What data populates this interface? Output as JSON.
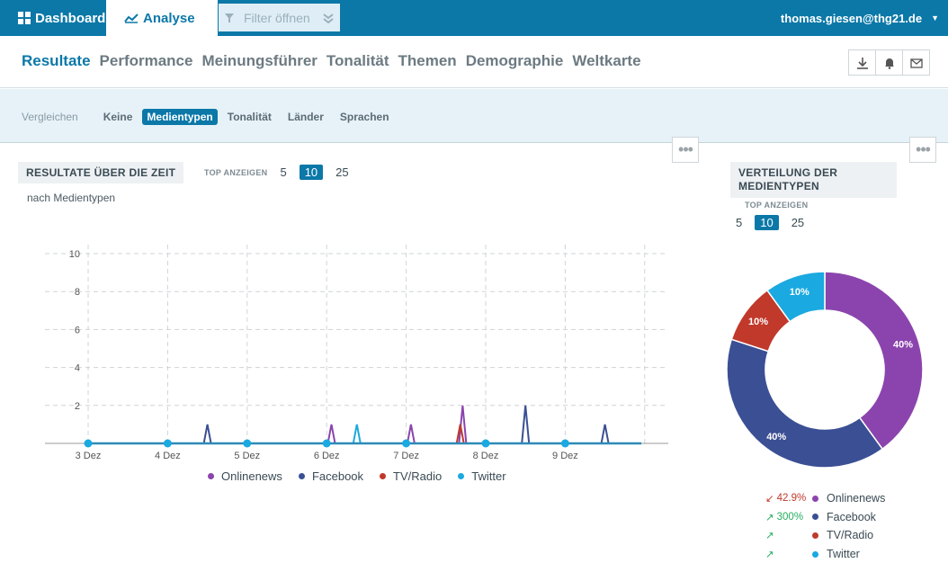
{
  "colors": {
    "accent": "#0b78a8",
    "online": "#8b44ad",
    "facebook": "#3b4f94",
    "tvradio": "#c0392b",
    "twitter": "#1aa9e0"
  },
  "topbar": {
    "dashboard": "Dashboard",
    "analyse": "Analyse",
    "filter": "Filter öffnen",
    "user": "thomas.giesen@thg21.de"
  },
  "nav": [
    "Resultate",
    "Performance",
    "Meinungsführer",
    "Tonalität",
    "Themen",
    "Demographie",
    "Weltkarte"
  ],
  "compare": {
    "label": "Vergleichen",
    "options": [
      "Keine",
      "Medientypen",
      "Tonalität",
      "Länder",
      "Sprachen"
    ],
    "active": "Medientypen"
  },
  "timeline": {
    "title": "RESULTATE ÜBER DIE ZEIT",
    "top_label": "TOP ANZEIGEN",
    "top_options": [
      "5",
      "10",
      "25"
    ],
    "subtitle": "nach Medientypen"
  },
  "distribution": {
    "title_line1": "VERTEILUNG DER",
    "title_line2": "MEDIENTYPEN",
    "top_label": "TOP ANZEIGEN",
    "top_options": [
      "5",
      "10",
      "25"
    ],
    "table": [
      {
        "trend": "42.9%",
        "dir": "down",
        "name": "Onlinenews"
      },
      {
        "trend": "300%",
        "dir": "up",
        "name": "Facebook"
      },
      {
        "trend": "",
        "dir": "up",
        "name": "TV/Radio"
      },
      {
        "trend": "",
        "dir": "up",
        "name": "Twitter"
      }
    ]
  },
  "chart_data": [
    {
      "type": "line",
      "x": [
        "3 Dez",
        "4 Dez",
        "5 Dez",
        "6 Dez",
        "7 Dez",
        "8 Dez",
        "9 Dez"
      ],
      "yticks": [
        2,
        4,
        6,
        8,
        10
      ],
      "ylim": [
        0,
        10
      ],
      "series": [
        {
          "name": "Onlinenews",
          "values": [
            0,
            0,
            0,
            1,
            0,
            1,
            2
          ]
        },
        {
          "name": "Facebook",
          "values": [
            0,
            1,
            0,
            0,
            0,
            2,
            1
          ]
        },
        {
          "name": "TV/Radio",
          "values": [
            0,
            0,
            0,
            0,
            1,
            0,
            0
          ]
        },
        {
          "name": "Twitter",
          "values": [
            0,
            0,
            0,
            1,
            0,
            0,
            0
          ]
        }
      ]
    },
    {
      "type": "pie",
      "categories": [
        "Onlinenews",
        "Facebook",
        "TV/Radio",
        "Twitter"
      ],
      "values": [
        40,
        40,
        10,
        10
      ],
      "labels": [
        "40%",
        "40%",
        "10%",
        "10%"
      ]
    }
  ]
}
